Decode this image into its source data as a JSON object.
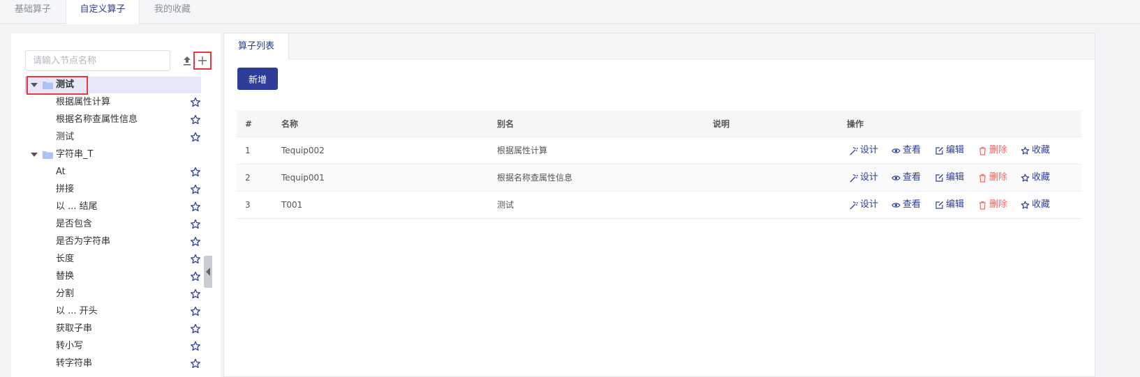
{
  "top_tabs": [
    {
      "label": "基础算子"
    },
    {
      "label": "自定义算子"
    },
    {
      "label": "我的收藏"
    }
  ],
  "sidebar": {
    "search_placeholder": "请输入节点名称",
    "tree": [
      {
        "type": "folder",
        "label": "测试",
        "selected": true
      },
      {
        "type": "leaf",
        "label": "根据属性计算"
      },
      {
        "type": "leaf",
        "label": "根据名称查属性信息"
      },
      {
        "type": "leaf",
        "label": "测试"
      },
      {
        "type": "folder",
        "label": "字符串_T"
      },
      {
        "type": "leaf",
        "label": "At"
      },
      {
        "type": "leaf",
        "label": "拼接"
      },
      {
        "type": "leaf",
        "label": "以 ... 结尾"
      },
      {
        "type": "leaf",
        "label": "是否包含"
      },
      {
        "type": "leaf",
        "label": "是否为字符串"
      },
      {
        "type": "leaf",
        "label": "长度"
      },
      {
        "type": "leaf",
        "label": "替换"
      },
      {
        "type": "leaf",
        "label": "分割"
      },
      {
        "type": "leaf",
        "label": "以 ... 开头"
      },
      {
        "type": "leaf",
        "label": "获取子串"
      },
      {
        "type": "leaf",
        "label": "转小写"
      },
      {
        "type": "leaf",
        "label": "转字符串"
      }
    ]
  },
  "main": {
    "tab_label": "算子列表",
    "add_button_label": "新增",
    "table": {
      "headers": [
        "#",
        "名称",
        "别名",
        "说明",
        "操作"
      ],
      "rows": [
        {
          "index": "1",
          "name": "Tequip002",
          "alias": "根据属性计算",
          "desc": ""
        },
        {
          "index": "2",
          "name": "Tequip001",
          "alias": "根据名称查属性信息",
          "desc": ""
        },
        {
          "index": "3",
          "name": "T001",
          "alias": "测试",
          "desc": ""
        }
      ],
      "actions": {
        "design": "设计",
        "view": "查看",
        "edit": "编辑",
        "delete": "删除",
        "favorite": "收藏"
      }
    }
  },
  "colors": {
    "primary": "#2d3d99",
    "danger": "#ee6b6b",
    "highlight_box": "#e8383d",
    "selected_row": "#e6e8fa",
    "folder": "#a9c5f5"
  }
}
